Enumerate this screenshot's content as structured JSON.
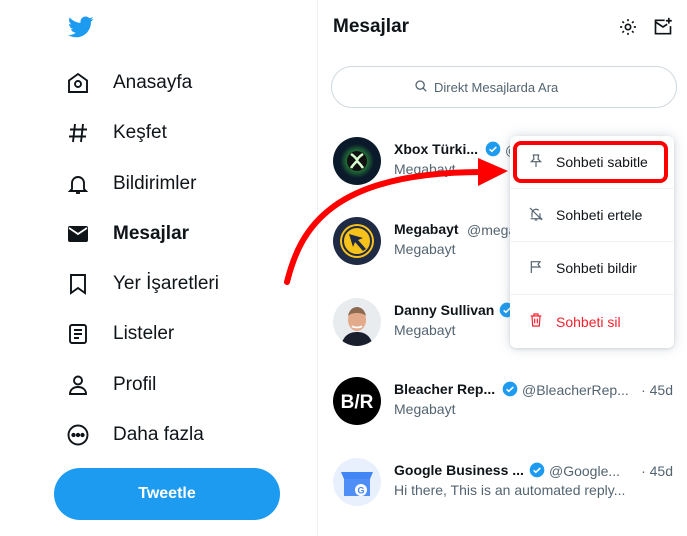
{
  "nav": {
    "items": [
      {
        "label": "Anasayfa",
        "icon": "home-icon"
      },
      {
        "label": "Keşfet",
        "icon": "hashtag-icon"
      },
      {
        "label": "Bildirimler",
        "icon": "bell-icon"
      },
      {
        "label": "Mesajlar",
        "icon": "mail-icon",
        "active": true
      },
      {
        "label": "Yer İşaretleri",
        "icon": "bookmark-icon"
      },
      {
        "label": "Listeler",
        "icon": "list-icon"
      },
      {
        "label": "Profil",
        "icon": "profile-icon"
      },
      {
        "label": "Daha fazla",
        "icon": "more-icon"
      }
    ],
    "tweet_button": "Tweetle"
  },
  "messages": {
    "title": "Mesajlar",
    "search_placeholder": "Direkt Mesajlarda Ara",
    "conversations": [
      {
        "name": "Xbox Türki...",
        "handle": "@",
        "time": "",
        "preview": "Megabayt",
        "verified": true
      },
      {
        "name": "Megabayt",
        "handle": "@mega",
        "time": "",
        "preview": "Megabayt",
        "verified": false
      },
      {
        "name": "Danny Sullivan",
        "handle": "",
        "time": "",
        "preview": "Megabayt",
        "verified": true
      },
      {
        "name": "Bleacher Rep...",
        "handle": "@BleacherRep...",
        "time": "· 45d",
        "preview": "Megabayt",
        "verified": true
      },
      {
        "name": "Google Business ...",
        "handle": "@Google...",
        "time": "· 45d",
        "preview": "Hi there, This is an automated reply...",
        "verified": true
      }
    ]
  },
  "context_menu": {
    "items": [
      {
        "label": "Sohbeti sabitle",
        "icon": "pin-icon"
      },
      {
        "label": "Sohbeti ertele",
        "icon": "mute-icon"
      },
      {
        "label": "Sohbeti bildir",
        "icon": "flag-icon"
      },
      {
        "label": "Sohbeti sil",
        "icon": "trash-icon",
        "danger": true
      }
    ]
  },
  "colors": {
    "accent": "#1d9bf0",
    "danger": "#f4212e",
    "annotation": "#ff0000"
  }
}
